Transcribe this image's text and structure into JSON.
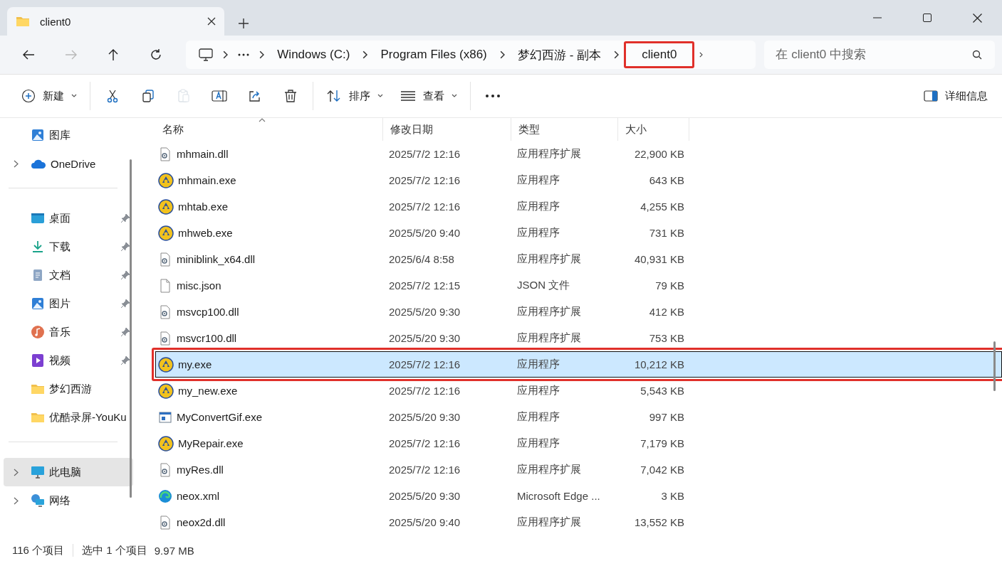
{
  "tab": {
    "title": "client0"
  },
  "nav": [
    {
      "kind": "back",
      "disabled": false
    },
    {
      "kind": "forward",
      "disabled": true
    },
    {
      "kind": "up",
      "disabled": false
    },
    {
      "kind": "refresh",
      "disabled": false
    }
  ],
  "breadcrumb": [
    {
      "kind": "pc"
    },
    {
      "kind": "overflow"
    },
    {
      "kind": "crumb",
      "label": "Windows (C:)",
      "highlighted": false
    },
    {
      "kind": "crumb",
      "label": "Program Files (x86)",
      "highlighted": false
    },
    {
      "kind": "crumb",
      "label": "梦幻西游 - 副本",
      "highlighted": false
    },
    {
      "kind": "crumb",
      "label": "client0",
      "highlighted": true
    }
  ],
  "search": {
    "placeholder": "在 client0 中搜索"
  },
  "toolbar": {
    "groups": [
      [
        {
          "kind": "new",
          "label": "新建",
          "dropdown": true,
          "disabled": false
        }
      ],
      [
        {
          "kind": "cut",
          "disabled": false
        },
        {
          "kind": "copy",
          "disabled": false
        },
        {
          "kind": "paste",
          "disabled": true
        },
        {
          "kind": "rename",
          "disabled": false
        },
        {
          "kind": "share",
          "disabled": false
        },
        {
          "kind": "delete",
          "disabled": false
        }
      ],
      [
        {
          "kind": "sort",
          "label": "排序",
          "dropdown": true,
          "disabled": false
        },
        {
          "kind": "view",
          "label": "查看",
          "dropdown": true,
          "disabled": false
        }
      ],
      [
        {
          "kind": "more",
          "disabled": false
        }
      ]
    ],
    "details": {
      "label": "详细信息"
    }
  },
  "sidebar": {
    "groups": [
      {
        "items": [
          {
            "kind": "gallery",
            "label": "图库",
            "expandable": false,
            "pinned": false,
            "selected": false
          },
          {
            "kind": "onedrive",
            "label": "OneDrive",
            "expandable": true,
            "pinned": false,
            "selected": false
          }
        ]
      },
      {
        "items": [
          {
            "kind": "desktop",
            "label": "桌面",
            "expandable": false,
            "pinned": true,
            "selected": false
          },
          {
            "kind": "download",
            "label": "下载",
            "expandable": false,
            "pinned": true,
            "selected": false
          },
          {
            "kind": "docs",
            "label": "文档",
            "expandable": false,
            "pinned": true,
            "selected": false
          },
          {
            "kind": "pictures",
            "label": "图片",
            "expandable": false,
            "pinned": true,
            "selected": false
          },
          {
            "kind": "music",
            "label": "音乐",
            "expandable": false,
            "pinned": true,
            "selected": false
          },
          {
            "kind": "video",
            "label": "视频",
            "expandable": false,
            "pinned": true,
            "selected": false
          },
          {
            "kind": "folder",
            "label": "梦幻西游",
            "expandable": false,
            "pinned": false,
            "selected": false
          },
          {
            "kind": "folder",
            "label": "优酷录屏-YouKu",
            "expandable": false,
            "pinned": false,
            "selected": false
          }
        ]
      },
      {
        "items": [
          {
            "kind": "pc",
            "label": "此电脑",
            "expandable": true,
            "pinned": false,
            "selected": true
          },
          {
            "kind": "network",
            "label": "网络",
            "expandable": true,
            "pinned": false,
            "selected": false
          }
        ]
      }
    ]
  },
  "files": {
    "columns": [
      {
        "label": "名称",
        "sorted": true
      },
      {
        "label": "修改日期",
        "sorted": false
      },
      {
        "label": "类型",
        "sorted": false
      },
      {
        "label": "大小",
        "sorted": false
      }
    ],
    "rows": [
      {
        "kind": "dll",
        "name": "mhmain.dll",
        "date": "2025/7/2 12:16",
        "type": "应用程序扩展",
        "size": "22,900 KB",
        "selected": false,
        "highlighted": false
      },
      {
        "kind": "exe",
        "name": "mhmain.exe",
        "date": "2025/7/2 12:16",
        "type": "应用程序",
        "size": "643 KB",
        "selected": false,
        "highlighted": false
      },
      {
        "kind": "exe",
        "name": "mhtab.exe",
        "date": "2025/7/2 12:16",
        "type": "应用程序",
        "size": "4,255 KB",
        "selected": false,
        "highlighted": false
      },
      {
        "kind": "exe",
        "name": "mhweb.exe",
        "date": "2025/5/20 9:40",
        "type": "应用程序",
        "size": "731 KB",
        "selected": false,
        "highlighted": false
      },
      {
        "kind": "dll",
        "name": "miniblink_x64.dll",
        "date": "2025/6/4 8:58",
        "type": "应用程序扩展",
        "size": "40,931 KB",
        "selected": false,
        "highlighted": false
      },
      {
        "kind": "file",
        "name": "misc.json",
        "date": "2025/7/2 12:15",
        "type": "JSON 文件",
        "size": "79 KB",
        "selected": false,
        "highlighted": false
      },
      {
        "kind": "dll",
        "name": "msvcp100.dll",
        "date": "2025/5/20 9:30",
        "type": "应用程序扩展",
        "size": "412 KB",
        "selected": false,
        "highlighted": false
      },
      {
        "kind": "dll",
        "name": "msvcr100.dll",
        "date": "2025/5/20 9:30",
        "type": "应用程序扩展",
        "size": "753 KB",
        "selected": false,
        "highlighted": false
      },
      {
        "kind": "exe",
        "name": "my.exe",
        "date": "2025/7/2 12:16",
        "type": "应用程序",
        "size": "10,212 KB",
        "selected": true,
        "highlighted": true
      },
      {
        "kind": "exe",
        "name": "my_new.exe",
        "date": "2025/7/2 12:16",
        "type": "应用程序",
        "size": "5,543 KB",
        "selected": false,
        "highlighted": false
      },
      {
        "kind": "app",
        "name": "MyConvertGif.exe",
        "date": "2025/5/20 9:30",
        "type": "应用程序",
        "size": "997 KB",
        "selected": false,
        "highlighted": false
      },
      {
        "kind": "exe",
        "name": "MyRepair.exe",
        "date": "2025/7/2 12:16",
        "type": "应用程序",
        "size": "7,179 KB",
        "selected": false,
        "highlighted": false
      },
      {
        "kind": "dll",
        "name": "myRes.dll",
        "date": "2025/7/2 12:16",
        "type": "应用程序扩展",
        "size": "7,042 KB",
        "selected": false,
        "highlighted": false
      },
      {
        "kind": "edge",
        "name": "neox.xml",
        "date": "2025/5/20 9:30",
        "type": "Microsoft Edge ...",
        "size": "3 KB",
        "selected": false,
        "highlighted": false
      },
      {
        "kind": "dll",
        "name": "neox2d.dll",
        "date": "2025/5/20 9:40",
        "type": "应用程序扩展",
        "size": "13,552 KB",
        "selected": false,
        "highlighted": false
      }
    ]
  },
  "status": {
    "count": "116 个项目",
    "selection": "选中 1 个项目",
    "selection_size": "9.97 MB"
  }
}
